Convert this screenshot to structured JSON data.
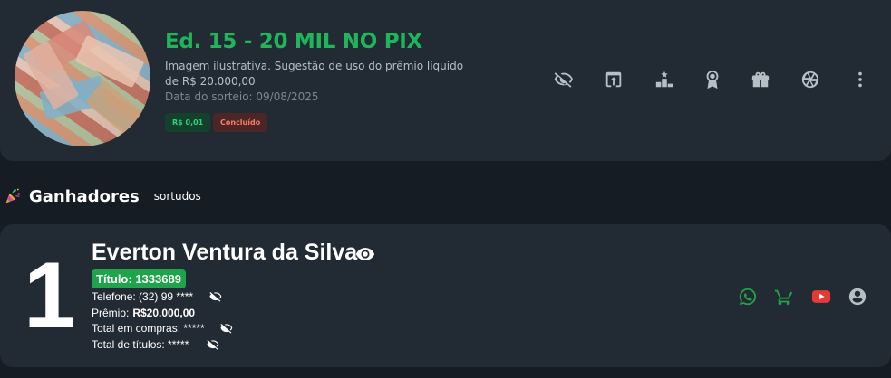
{
  "raffle": {
    "title": "Ed. 15 - 20 MIL NO PIX",
    "description": "Imagem ilustrativa. Sugestão de uso do prêmio líquido de R$ 20.000,00",
    "draw_date": "Data do sorteio: 09/08/2025",
    "price_badge": "R$ 0,01",
    "status_badge": "Concluído",
    "image_alt": "money-notes-image"
  },
  "toolbar": {
    "icons": [
      "eye-off-icon",
      "open-in-new-icon",
      "podium-icon",
      "award-icon",
      "gift-icon",
      "aperture-icon",
      "more-vertical-icon"
    ]
  },
  "section": {
    "title": "Ganhadores",
    "subtitle": "sortudos",
    "icon": "party-popper-icon"
  },
  "winner": {
    "rank": "1",
    "name": "Everton Ventura da Silva",
    "ticket": "Título: 1333689",
    "phone": "Telefone: (32) 99 ****",
    "prize_label": "Prêmio:",
    "prize_value": "R$20.000,00",
    "total_purchases": "Total em compras: *****",
    "total_tickets": "Total de títulos: *****"
  },
  "colors": {
    "accent_green": "#1fb55a",
    "whatsapp": "#25a04a",
    "cart": "#25a04a",
    "youtube": "#e53935",
    "user": "#b6bec6"
  }
}
